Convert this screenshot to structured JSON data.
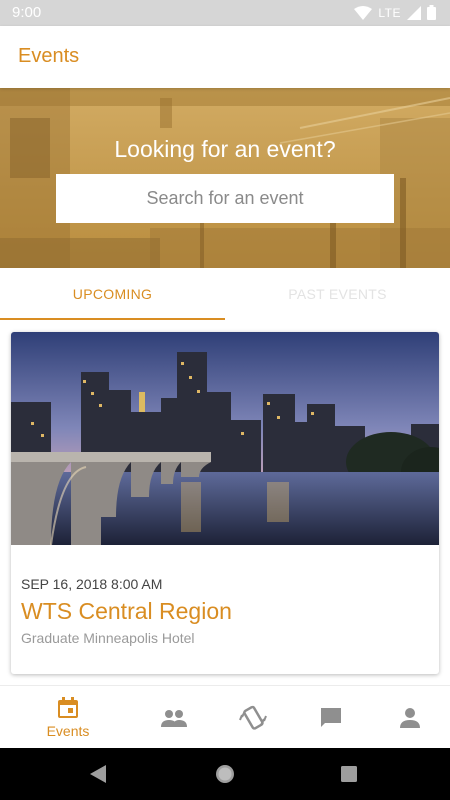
{
  "status_bar": {
    "time": "9:00",
    "network": "LTE"
  },
  "app_bar": {
    "title": "Events"
  },
  "hero": {
    "title": "Looking for an event?",
    "search_placeholder": "Search for an event"
  },
  "tabs": [
    {
      "label": "UPCOMING",
      "selected": true
    },
    {
      "label": "PAST EVENTS",
      "selected": false
    }
  ],
  "events": [
    {
      "date": "SEP 16, 2018 8:00 AM",
      "name": "WTS Central Region",
      "venue": "Graduate Minneapolis Hotel",
      "image": "city-skyline-bridge-photo"
    }
  ],
  "bottom_nav": [
    {
      "icon": "calendar-icon",
      "label": "Events",
      "active": true
    },
    {
      "icon": "people-icon",
      "label": "",
      "active": false
    },
    {
      "icon": "phone-shake-icon",
      "label": "",
      "active": false
    },
    {
      "icon": "chat-icon",
      "label": "",
      "active": false
    },
    {
      "icon": "person-icon",
      "label": "",
      "active": false
    }
  ],
  "colors": {
    "accent": "#d98d22",
    "inactive_icon": "#8f8f8f",
    "status_bar": "#d6d6d6"
  }
}
